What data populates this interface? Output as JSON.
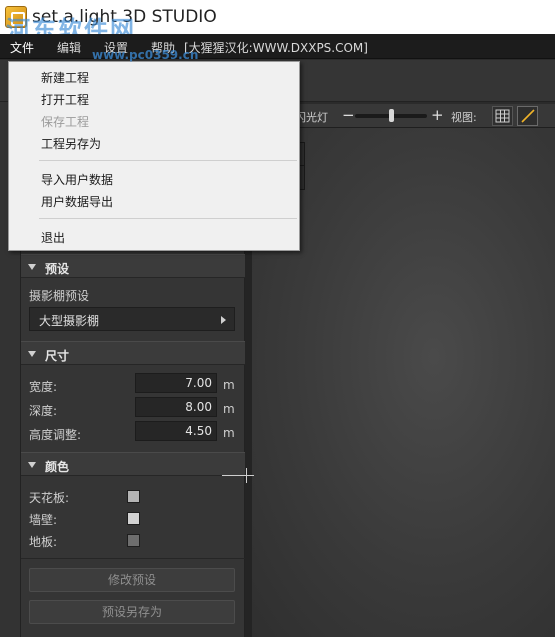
{
  "window": {
    "title": "set.a.light 3D STUDIO"
  },
  "watermark": {
    "text": "河东软件网",
    "url": "www.pc0359.cn"
  },
  "menubar": {
    "items": [
      "文件",
      "编辑",
      "设置",
      "帮助"
    ],
    "note": "[大猩猩汉化:WWW.DXXPS.COM]"
  },
  "file_menu": {
    "items": [
      {
        "label": "新建工程",
        "enabled": true
      },
      {
        "label": "打开工程",
        "enabled": true
      },
      {
        "label": "保存工程",
        "enabled": false
      },
      {
        "label": "工程另存为",
        "enabled": true
      },
      {
        "label": "导入用户数据",
        "enabled": true
      },
      {
        "label": "用户数据导出",
        "enabled": true
      },
      {
        "label": "退出",
        "enabled": true
      }
    ]
  },
  "viewport_toolbar": {
    "lamp_label": "闪光灯",
    "zoom_minus": "−",
    "zoom_plus": "+",
    "view_label": "视图:"
  },
  "panel": {
    "preset": {
      "title": "预设",
      "field_label": "摄影棚预设",
      "selected": "大型摄影棚"
    },
    "size": {
      "title": "尺寸",
      "unit": "m",
      "fields": [
        {
          "label": "宽度:",
          "value": "7.00"
        },
        {
          "label": "深度:",
          "value": "8.00"
        },
        {
          "label": "高度调整:",
          "value": "4.50"
        }
      ]
    },
    "color": {
      "title": "颜色",
      "fields": [
        {
          "label": "天花板:",
          "swatch": "#b4b4b4"
        },
        {
          "label": "墙壁:",
          "swatch": "#d2d2d2"
        },
        {
          "label": "地板:",
          "swatch": "#6e6e6e"
        }
      ]
    },
    "buttons": {
      "modify": "修改预设",
      "save_as": "预设另存为"
    }
  },
  "colors": {
    "menu_bg": "#1c1c1c",
    "panel_bg": "#353535",
    "dropdown_bg": "#f0f0f0",
    "icon_orange": "#f6c23c"
  }
}
